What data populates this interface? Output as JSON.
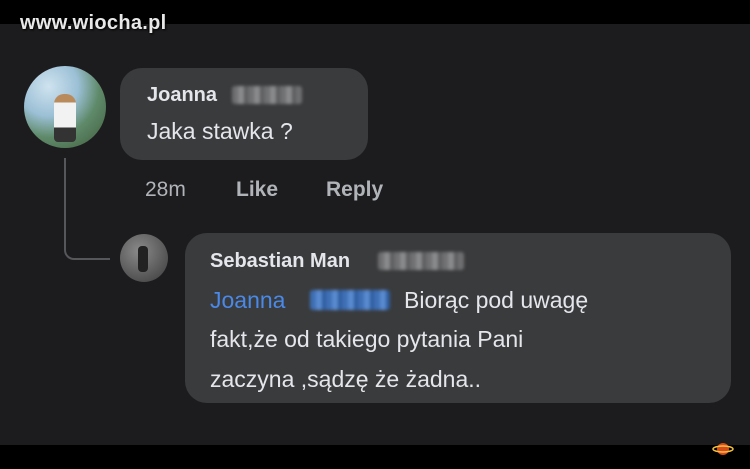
{
  "watermark": "www.wiocha.pl",
  "comment": {
    "author": "Joanna",
    "text": "Jaka stawka ?",
    "time": "28m",
    "like_label": "Like",
    "reply_label": "Reply"
  },
  "reply": {
    "author": "Sebastian Man",
    "mention": "Joanna",
    "line1": "Biorąc pod uwagę",
    "line2": "fakt,że od takiego pytania Pani",
    "line3": "zaczyna ,sądzę że żadna.."
  },
  "colors": {
    "background": "#1c1c1e",
    "bubble": "#3a3b3c",
    "text": "#e4e6eb",
    "muted": "#b0b3b8",
    "mention": "#4a89e8"
  },
  "icons": [
    "planet-logo-icon"
  ]
}
